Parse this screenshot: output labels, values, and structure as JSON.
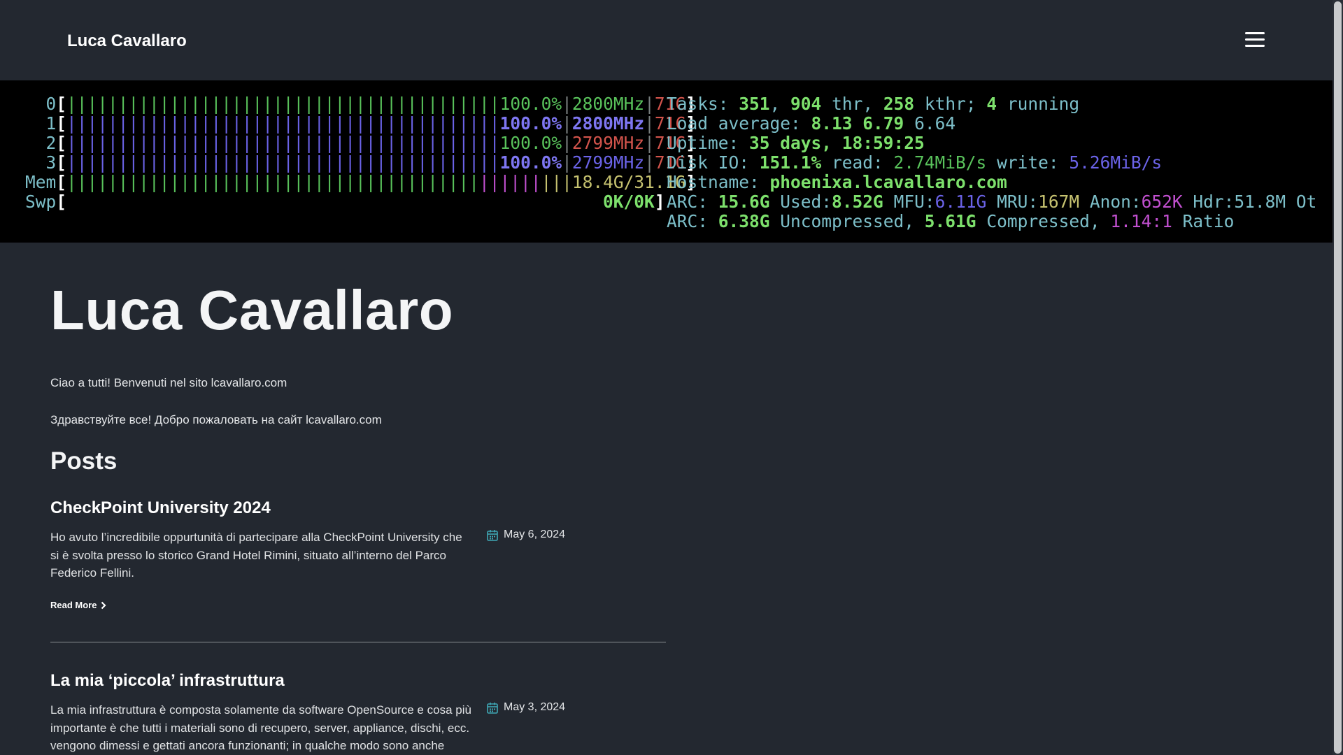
{
  "header": {
    "site_title": "Luca Cavallaro",
    "menu_icon": "hamburger-menu-icon"
  },
  "banner": {
    "cpu_rows": [
      {
        "id": "0",
        "pct": "100.0%",
        "freq": "2800MHz",
        "temp": "71C"
      },
      {
        "id": "1",
        "pct": "100.0%",
        "freq": "2800MHz",
        "temp": "71C"
      },
      {
        "id": "2",
        "pct": "100.0%",
        "freq": "2799MHz",
        "temp": "71C"
      },
      {
        "id": "3",
        "pct": "100.0%",
        "freq": "2799MHz",
        "temp": "71C"
      }
    ],
    "mem_label": "Mem",
    "mem_value": "18.4G/31.1G",
    "swp_label": "Swp",
    "swp_value": "0K/0K",
    "tasks_label": "Tasks: ",
    "tasks_count": "351",
    "threads": "904",
    "thr_label": " thr, ",
    "kthreads": "258",
    "kthr_label": " kthr; ",
    "running": "4",
    "running_label": " running",
    "load_label": "Load average: ",
    "load1": "8.13",
    "load5": "6.79",
    "load15": "6.64",
    "uptime_label": "Uptime: ",
    "uptime_value": "35 days, 18:59:25",
    "disk_label": "Disk IO: ",
    "disk_pct": "151.1%",
    "disk_read_label": " read: ",
    "disk_read": "2.74MiB/s",
    "disk_write_label": " write: ",
    "disk_write": "5.26MiB/s",
    "hostname_label": "Hostname: ",
    "hostname": "phoenixa.lcavallaro.com",
    "arc1_label": "ARC: ",
    "arc1_size": "15.6G",
    "arc1_used_label": " Used:",
    "arc1_used": "8.52G",
    "arc1_mfu_label": " MFU:",
    "arc1_mfu": "6.11G",
    "arc1_mru_label": " MRU:",
    "arc1_mru": "167M",
    "arc1_anon_label": " Anon:",
    "arc1_anon": "652K",
    "arc1_hdr": " Hdr:51.8M Ot",
    "arc2_label": "ARC: ",
    "arc2_uncomp": "6.38G",
    "arc2_uncomp_label": " Uncompressed, ",
    "arc2_comp": "5.61G",
    "arc2_comp_label": " Compressed, ",
    "arc2_ratio": "1.14:1",
    "arc2_ratio_label": " Ratio"
  },
  "main": {
    "title": "Luca Cavallaro",
    "intro_it": "Ciao a tutti! Benvenuti nel sito lcavallaro.com",
    "intro_ru": "Здравствуйте все! Добро пожаловать на сайт lcavallaro.com",
    "posts_heading": "Posts",
    "read_more_label": "Read More",
    "posts": [
      {
        "title": "CheckPoint University 2024",
        "excerpt": "Ho avuto l’incredibile oppurtunità di partecipare alla CheckPoint University che si è svolta presso lo storico Grand Hotel Rimini, situato all’interno del Parco Federico Fellini.",
        "date": "May 6, 2024"
      },
      {
        "title": "La mia ‘piccola’ infrastruttura",
        "excerpt": "La mia infrastruttura è composta solamente da software OpenSource e cosa più importante è che tutti i materiali sono di recupero, server, appliance, dischi, ecc. vengono dimessi e gettati ancora funzionanti; in qualche modo sono anche",
        "date": "May 3, 2024"
      }
    ]
  },
  "colors": {
    "page_background": "#232830",
    "banner_background": "#000000",
    "calendar_icon": "#3fa7b5",
    "htop_green": "#59c25b",
    "htop_blue": "#6b63e8",
    "htop_red": "#d3544c",
    "htop_cyan": "#7dbfc9"
  }
}
